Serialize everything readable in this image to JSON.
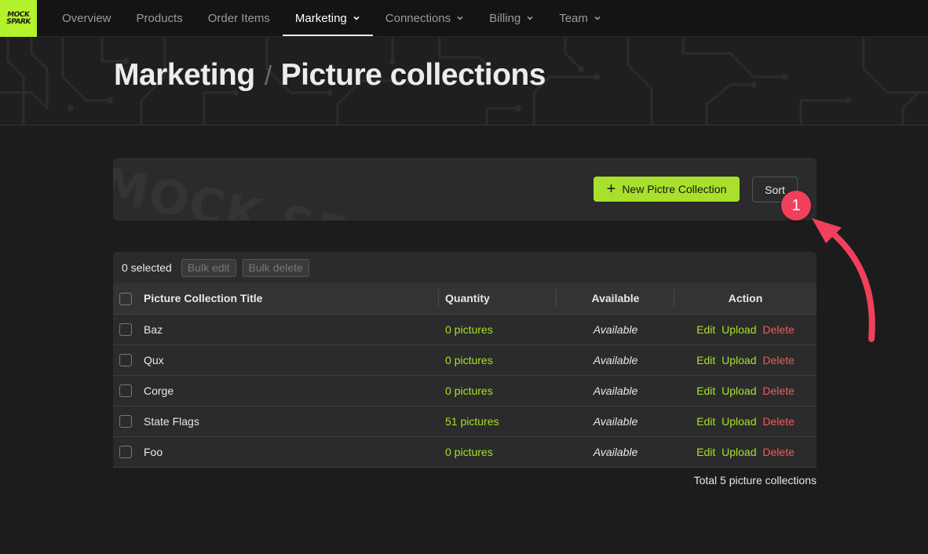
{
  "logo": {
    "line1": "MOCK",
    "line2": "SPARK"
  },
  "nav": {
    "items": [
      {
        "label": "Overview",
        "dropdown": false,
        "active": false
      },
      {
        "label": "Products",
        "dropdown": false,
        "active": false
      },
      {
        "label": "Order Items",
        "dropdown": false,
        "active": false
      },
      {
        "label": "Marketing",
        "dropdown": true,
        "active": true
      },
      {
        "label": "Connections",
        "dropdown": true,
        "active": false
      },
      {
        "label": "Billing",
        "dropdown": true,
        "active": false
      },
      {
        "label": "Team",
        "dropdown": true,
        "active": false
      }
    ]
  },
  "header": {
    "breadcrumb_parent": "Marketing",
    "separator": "/",
    "title": "Picture collections"
  },
  "toolbar": {
    "watermark": "MOCK SPARK",
    "new_label": "New Pictre Collection",
    "sort_label": "Sort"
  },
  "bulk": {
    "selected_text": "0 selected",
    "bulk_edit": "Bulk edit",
    "bulk_delete": "Bulk delete"
  },
  "table": {
    "columns": [
      "Picture Collection Title",
      "Quantity",
      "Available",
      "Action"
    ],
    "rows": [
      {
        "title": "Baz",
        "quantity": "0 pictures",
        "available": "Available"
      },
      {
        "title": "Qux",
        "quantity": "0 pictures",
        "available": "Available"
      },
      {
        "title": "Corge",
        "quantity": "0 pictures",
        "available": "Available"
      },
      {
        "title": "State Flags",
        "quantity": "51 pictures",
        "available": "Available"
      },
      {
        "title": "Foo",
        "quantity": "0 pictures",
        "available": "Available"
      }
    ],
    "actions": {
      "edit": "Edit",
      "upload": "Upload",
      "delete": "Delete"
    }
  },
  "footer": {
    "total": "Total 5 picture collections"
  },
  "annotation": {
    "badge": "1"
  },
  "colors": {
    "accent": "#a8e02c",
    "logo_bg": "#b4f22b",
    "danger": "#ef5b5b",
    "annotation": "#f0405c",
    "background": "#1c1c1c"
  }
}
